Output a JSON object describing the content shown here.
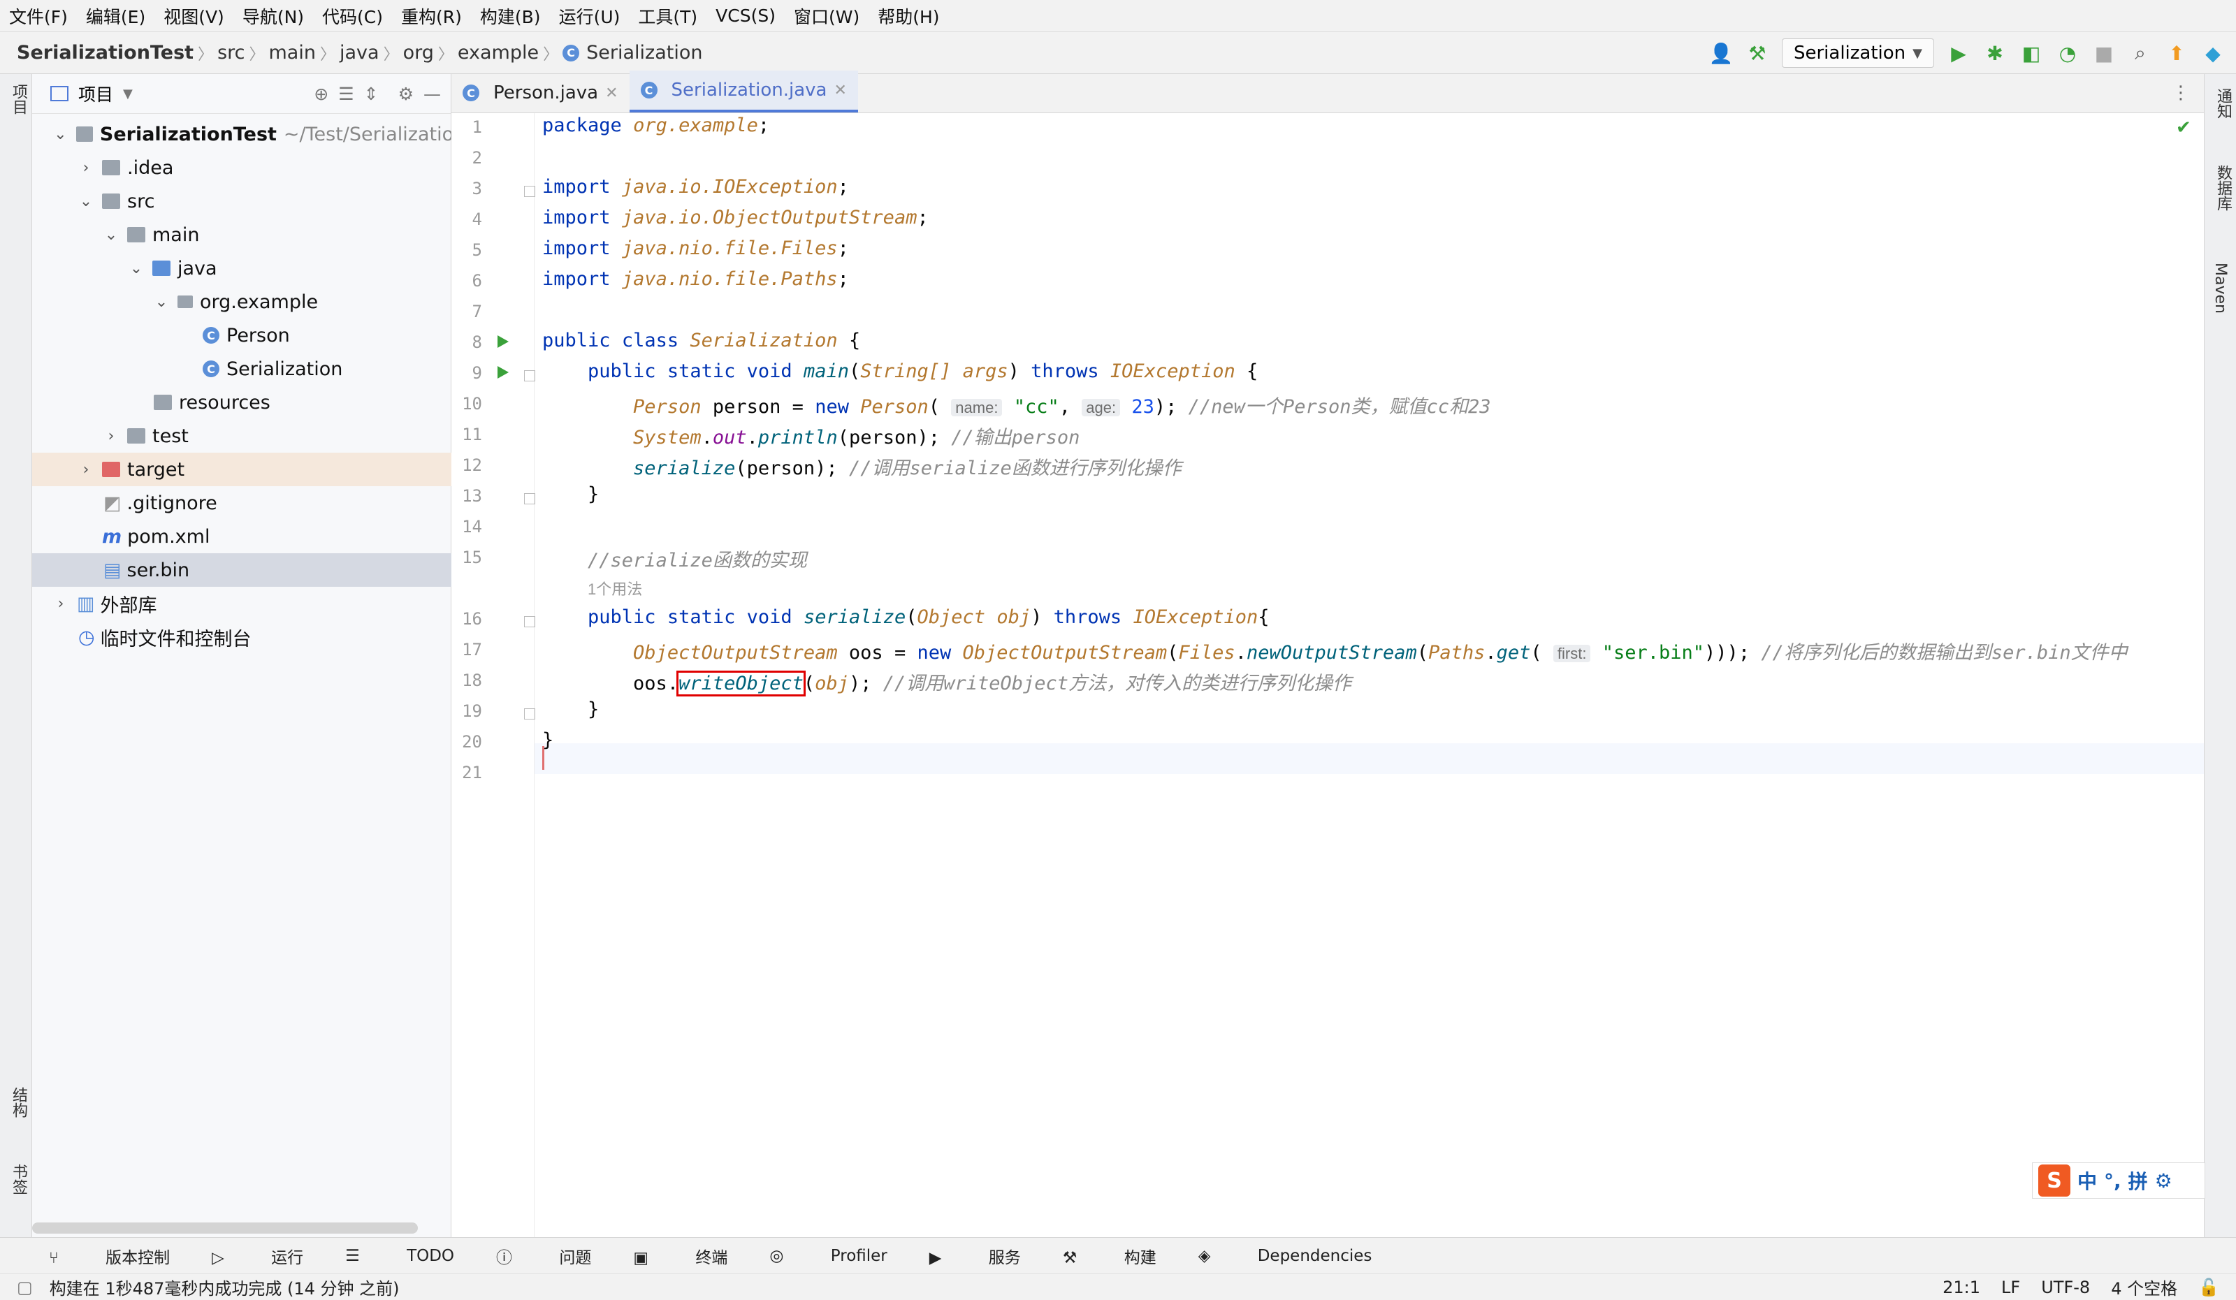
{
  "menu": [
    "文件(F)",
    "编辑(E)",
    "视图(V)",
    "导航(N)",
    "代码(C)",
    "重构(R)",
    "构建(B)",
    "运行(U)",
    "工具(T)",
    "VCS(S)",
    "窗口(W)",
    "帮助(H)"
  ],
  "breadcrumb": [
    "SerializationTest",
    "src",
    "main",
    "java",
    "org",
    "example",
    "Serialization"
  ],
  "run_config": "Serialization",
  "left_strip": {
    "project": "项目",
    "structure": "结构",
    "bookmarks": "书签"
  },
  "right_strip": {
    "notify": "通知",
    "database": "数据库",
    "maven": "Maven"
  },
  "project_panel": {
    "title": "项目",
    "root_name": "SerializationTest",
    "root_path": "~/Test/SerializationTe",
    "items": [
      {
        "label": ".idea"
      },
      {
        "label": "src"
      },
      {
        "label": "main"
      },
      {
        "label": "java"
      },
      {
        "label": "org.example"
      },
      {
        "label": "Person"
      },
      {
        "label": "Serialization"
      },
      {
        "label": "resources"
      },
      {
        "label": "test"
      },
      {
        "label": "target"
      },
      {
        "label": ".gitignore"
      },
      {
        "label": "pom.xml"
      },
      {
        "label": "ser.bin"
      },
      {
        "label": "外部库"
      },
      {
        "label": "临时文件和控制台"
      }
    ]
  },
  "tabs": [
    {
      "label": "Person.java"
    },
    {
      "label": "Serialization.java"
    }
  ],
  "code": {
    "l1_kw": "package",
    "l1_pkg": "org.example",
    "semi": ";",
    "import": "import",
    "l3": "java.io.IOException",
    "l4": "java.io.ObjectOutputStream",
    "l5": "java.nio.file.Files",
    "l6": "java.nio.file.Paths",
    "public": "public",
    "class": "class",
    "static": "static",
    "void": "void",
    "throws": "throws",
    "new": "new",
    "class_name": "Serialization",
    "main": "main",
    "string_arr": "String[]",
    "args": "args",
    "ioexception": "IOException",
    "person_type": "Person",
    "person_var": "person",
    "hint_name": "name:",
    "str_cc": "\"cc\"",
    "hint_age": "age:",
    "num_23": "23",
    "cm10": "//new一个Person类，赋值cc和23",
    "system": "System",
    "out": "out",
    "println": "println",
    "cm11": "//输出person",
    "serialize": "serialize",
    "cm12": "//调用serialize函数进行序列化操作",
    "cm15": "//serialize函数的实现",
    "usage": "1个用法",
    "object_type": "Object",
    "obj": "obj",
    "oos_type": "ObjectOutputStream",
    "oos": "oos",
    "files": "Files",
    "new_output_stream": "newOutputStream",
    "paths": "Paths",
    "get": "get",
    "hint_first": "first:",
    "str_ser": "\"ser.bin\"",
    "cm17": "//将序列化后的数据输出到ser.bin文件中",
    "write_object": "writeObject",
    "cm18": "//调用writeObject方法，对传入的类进行序列化操作"
  },
  "line_numbers": [
    "1",
    "2",
    "3",
    "4",
    "5",
    "6",
    "7",
    "8",
    "9",
    "10",
    "11",
    "12",
    "13",
    "14",
    "15",
    "16",
    "17",
    "18",
    "19",
    "20",
    "21"
  ],
  "bottom_tools": [
    "版本控制",
    "运行",
    "TODO",
    "问题",
    "终端",
    "Profiler",
    "服务",
    "构建",
    "Dependencies"
  ],
  "status": {
    "message": "构建在 1秒487毫秒内成功完成 (14 分钟 之前)",
    "position": "21:1",
    "line_sep": "LF",
    "encoding": "UTF-8",
    "indent": "4 个空格"
  },
  "ime": {
    "logo": "S",
    "lang": "中",
    "punct": "°,",
    "mode": "拼",
    "settings_icon": "gear-icon"
  },
  "colors": {
    "accent": "#4f7ad8",
    "run_green": "#3aa13a",
    "highlight_box": "#e00000"
  }
}
